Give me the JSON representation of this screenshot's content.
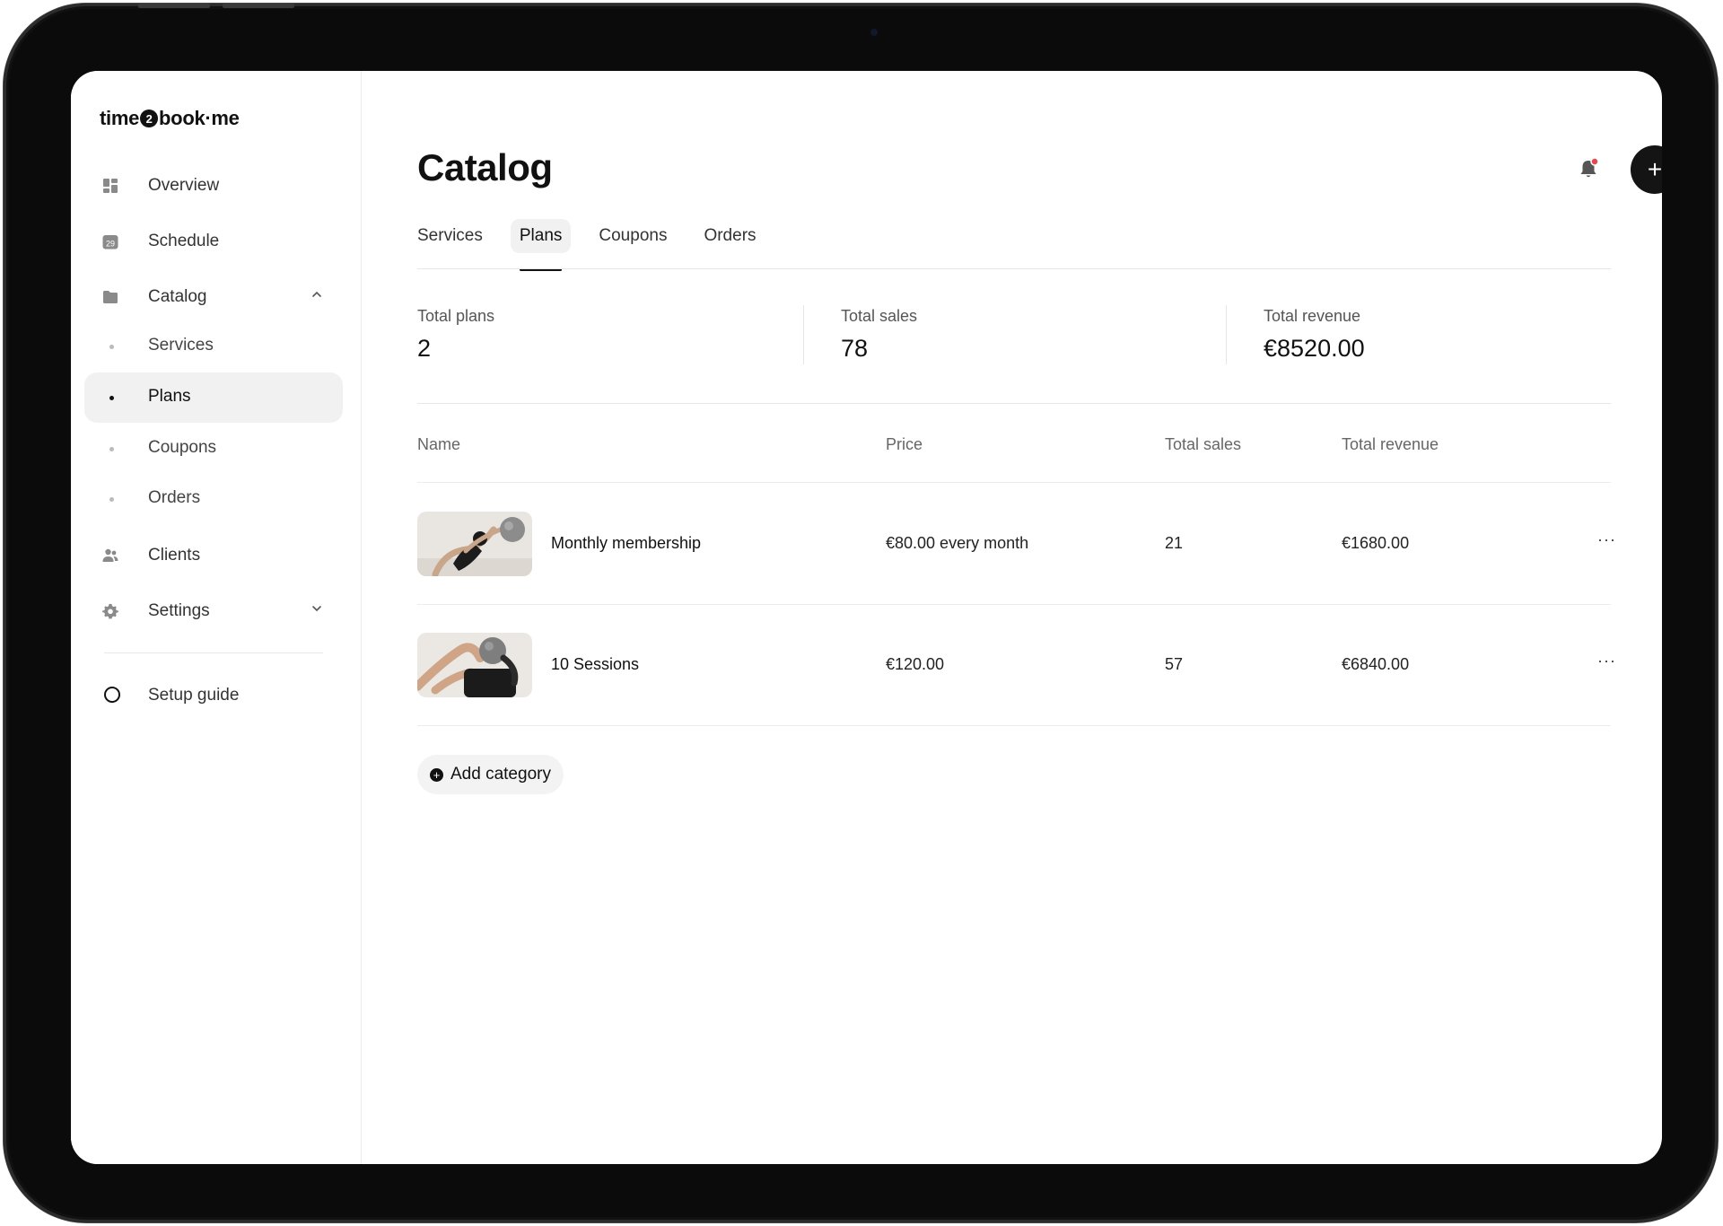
{
  "brand": {
    "logo_left": "time",
    "logo_mid": "2",
    "logo_right": "book·me"
  },
  "sidebar": {
    "items": [
      {
        "label": "Overview",
        "icon": "grid-icon"
      },
      {
        "label": "Schedule",
        "icon": "calendar-icon",
        "badge": "29"
      },
      {
        "label": "Catalog",
        "icon": "folder-icon",
        "expanded": true
      },
      {
        "label": "Clients",
        "icon": "users-icon"
      },
      {
        "label": "Settings",
        "icon": "gear-icon",
        "expanded": false
      }
    ],
    "catalog_sub": [
      "Services",
      "Plans",
      "Coupons",
      "Orders"
    ],
    "active_sub": "Plans",
    "setup_guide": "Setup guide"
  },
  "header": {
    "title": "Catalog",
    "notification_dot_color": "#e5484d"
  },
  "tabs": [
    {
      "label": "Services",
      "active": false
    },
    {
      "label": "Plans",
      "active": true
    },
    {
      "label": "Coupons",
      "active": false
    },
    {
      "label": "Orders",
      "active": false
    }
  ],
  "stats": [
    {
      "label": "Total plans",
      "value": "2"
    },
    {
      "label": "Total sales",
      "value": "78"
    },
    {
      "label": "Total revenue",
      "value": "€8520.00"
    }
  ],
  "table": {
    "headers": [
      "Name",
      "Price",
      "Total sales",
      "Total revenue"
    ],
    "rows": [
      {
        "name": "Monthly membership",
        "price": "€80.00 every month",
        "sales": "21",
        "revenue": "€1680.00"
      },
      {
        "name": "10 Sessions",
        "price": "€120.00",
        "sales": "57",
        "revenue": "€6840.00"
      }
    ],
    "row_menu": "···"
  },
  "add_category": "Add category"
}
